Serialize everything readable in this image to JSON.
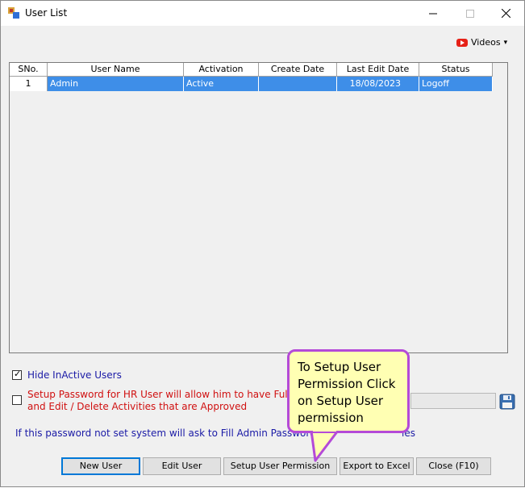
{
  "window": {
    "title": "User List"
  },
  "videos": {
    "label": "Videos",
    "caret": "▾"
  },
  "grid": {
    "columns": [
      "SNo.",
      "User Name",
      "Activation",
      "Create Date",
      "Last Edit Date",
      "Status"
    ],
    "rows": [
      {
        "sno": "1",
        "user_name": "Admin",
        "activation": "Active",
        "create_date": "",
        "last_edit_date": "18/08/2023",
        "status": "Logoff"
      }
    ]
  },
  "options": {
    "hide_inactive": {
      "checked": true,
      "label": "Hide InActive Users"
    },
    "setup_password": {
      "checked": false,
      "line1": "Setup Password for HR User will allow him to have Full Acce",
      "line2": "and Edit / Delete  Activities that are Approved"
    },
    "info": "If this password not set system will ask to Fill Admin Password w",
    "info_tail": "ies"
  },
  "buttons": {
    "new_user": "New User",
    "edit_user": "Edit User",
    "setup_permission": "Setup User Permission",
    "export_excel": "Export to Excel",
    "close": "Close (F10)"
  },
  "callout": {
    "text": "To Setup User Permission Click on Setup User permission"
  },
  "colors": {
    "selection": "#3e8ee8",
    "callout_border": "#b44ad8",
    "callout_fill": "#ffffb3",
    "info_text": "#1a1aa6",
    "warning_text": "#d01010"
  }
}
